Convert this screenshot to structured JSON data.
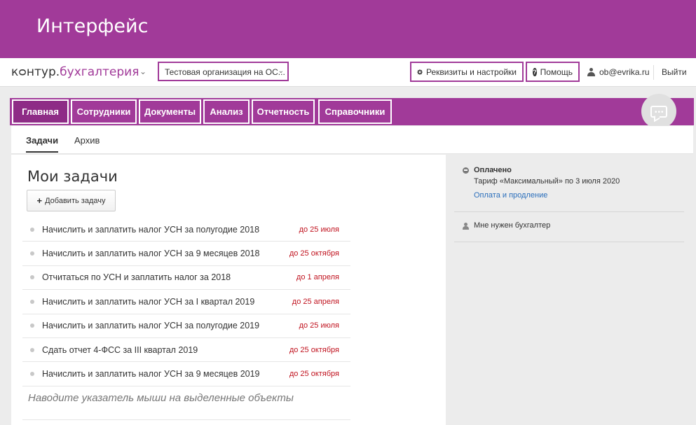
{
  "banner": {
    "title": "Интерфейс"
  },
  "header": {
    "logo_prefix": "кᴑнтур.",
    "logo_accent": "бухгалтерия",
    "org_select_value": "Тестовая организация на ОС...",
    "settings_label": "Реквизиты и настройки",
    "help_label": "Помощь",
    "user_email": "ob@evrika.ru",
    "logout_label": "Выйти"
  },
  "nav": {
    "tabs": [
      {
        "label": "Главная",
        "active": true
      },
      {
        "label": "Сотрудники"
      },
      {
        "label": "Документы"
      },
      {
        "label": "Анализ"
      },
      {
        "label": "Отчетность"
      },
      {
        "label": "Справочники"
      }
    ]
  },
  "subnav": {
    "tabs": [
      {
        "label": "Задачи",
        "active": true
      },
      {
        "label": "Архив"
      }
    ]
  },
  "main": {
    "title": "Мои задачи",
    "add_task_label": "Добавить задачу",
    "tasks": [
      {
        "text": "Начислить и заплатить налог УСН за полугодие 2018",
        "due": "до 25 июля"
      },
      {
        "text": "Начислить и заплатить налог УСН за 9 месяцев 2018",
        "due": "до 25 октября"
      },
      {
        "text": "Отчитаться по УСН и заплатить налог за 2018",
        "due": "до 1 апреля"
      },
      {
        "text": "Начислить и заплатить налог УСН за I квартал 2019",
        "due": "до 25 апреля"
      },
      {
        "text": "Начислить и заплатить налог УСН за полугодие 2019",
        "due": "до 25 июля"
      },
      {
        "text": "Сдать отчет 4-ФСС за III квартал 2019",
        "due": "до 25 октября"
      },
      {
        "text": "Начислить и заплатить налог УСН за 9 месяцев 2019",
        "due": "до 25 октября"
      }
    ],
    "hint": "Наводите указатель мыши на выделенные объекты"
  },
  "side": {
    "paid_title": "Оплачено",
    "paid_desc": "Тариф «Максимальный» по 3 июля 2020",
    "paid_link": "Оплата и продление",
    "accountant": "Мне нужен бухгалтер"
  },
  "colors": {
    "brand": "#a13a99",
    "due": "#c0121e",
    "link": "#2a6ebb"
  }
}
